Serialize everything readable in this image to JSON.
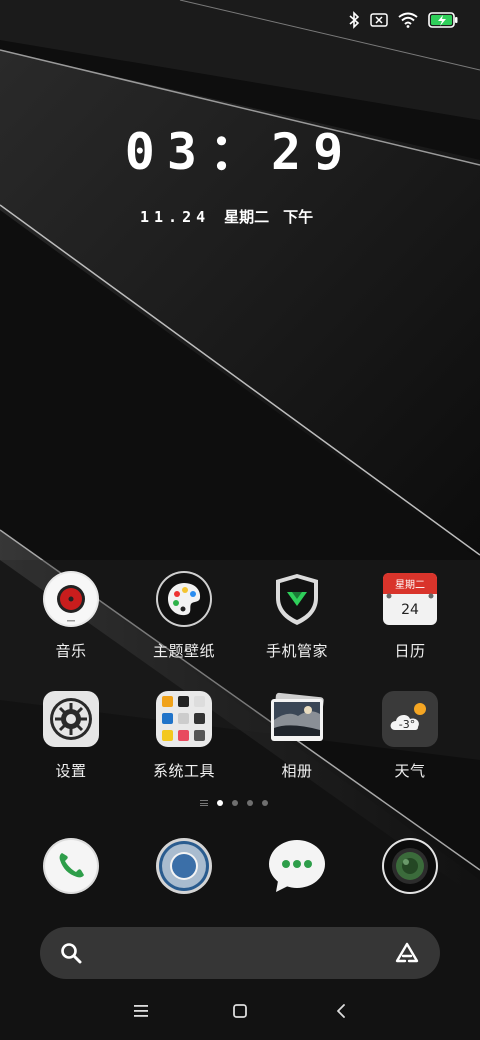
{
  "status_bar": {
    "icons": [
      "bluetooth-icon",
      "sim-no-signal-icon",
      "wifi-icon",
      "battery-charging-icon"
    ]
  },
  "lock": {
    "time": "03：29",
    "date": "11.24",
    "weekday": "星期二",
    "period": "下午"
  },
  "apps": [
    {
      "label": "音乐",
      "icon": "music-icon"
    },
    {
      "label": "主题壁纸",
      "icon": "theme-palette-icon"
    },
    {
      "label": "手机管家",
      "icon": "security-shield-icon"
    },
    {
      "label": "日历",
      "icon": "calendar-icon",
      "icon_weekday": "星期二",
      "icon_day": "24"
    },
    {
      "label": "设置",
      "icon": "settings-gear-icon"
    },
    {
      "label": "系统工具",
      "icon": "folder-icon"
    },
    {
      "label": "相册",
      "icon": "gallery-icon"
    },
    {
      "label": "天气",
      "icon": "weather-icon",
      "temperature": "-3°"
    }
  ],
  "page_indicator": {
    "pages": 4,
    "active": 0
  },
  "dock": [
    {
      "icon": "phone-icon"
    },
    {
      "icon": "browser-icon"
    },
    {
      "icon": "messages-icon"
    },
    {
      "icon": "camera-icon"
    }
  ],
  "search": {
    "left_icon": "search-icon",
    "right_icon": "assistant-icon"
  },
  "nav": {
    "buttons": [
      "menu-icon",
      "home-icon",
      "back-icon"
    ]
  },
  "colors": {
    "accent_green": "#2fcf5a",
    "calendar_red": "#d9342b",
    "background": "#0d0d0d"
  }
}
